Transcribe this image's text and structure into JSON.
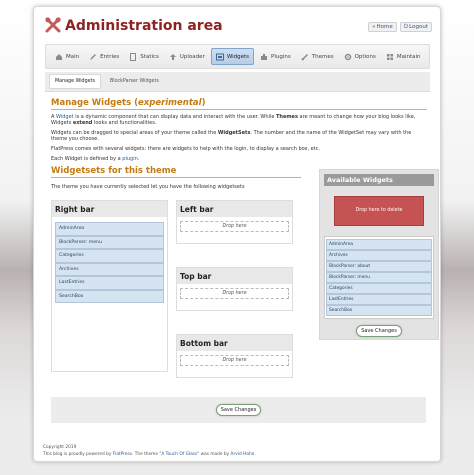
{
  "header": {
    "title": "Administration area",
    "home_label": "Home",
    "logout_label": "Logout"
  },
  "nav": {
    "items": [
      {
        "label": "Main",
        "icon": "house-icon"
      },
      {
        "label": "Entries",
        "icon": "pencil-icon"
      },
      {
        "label": "Statics",
        "icon": "page-icon"
      },
      {
        "label": "Uploader",
        "icon": "upload-icon"
      },
      {
        "label": "Widgets",
        "icon": "widgets-icon"
      },
      {
        "label": "Plugins",
        "icon": "puzzle-icon"
      },
      {
        "label": "Themes",
        "icon": "brush-icon"
      },
      {
        "label": "Options",
        "icon": "gear-icon"
      },
      {
        "label": "Maintain",
        "icon": "grid-icon"
      }
    ],
    "active": "Widgets"
  },
  "subnav": {
    "items": [
      "Manage Widgets",
      "BlockParser Widgets"
    ]
  },
  "intro": {
    "heading_main": "Manage Widgets (",
    "heading_em": "experimental",
    "heading_end": ")",
    "p1_a": "A ",
    "p1_link": "Widget",
    "p1_b": " is a dynamic component that can display data and interact with the user. While ",
    "p1_bold1": "Themes",
    "p1_c": " are meant to change how your blog looks like, Widgets ",
    "p1_bold2": "extend",
    "p1_d": " looks and functionalities.",
    "p2_a": "Widgets can be dragged to special areas of your theme called the ",
    "p2_bold": "WidgetSets",
    "p2_b": ". The number and the name of the WidgetSet may vary with the theme you choose.",
    "p3": "FlatPress comes with several widgets: there are widgets to help with the login, to display a search box, etc.",
    "p4_a": "Each Widget is defined by a ",
    "p4_link": "plugin",
    "p4_b": "."
  },
  "widgetsets": {
    "heading": "Widgetsets for this theme",
    "subtitle": "The theme you have currently selected let you have the following widgetsets",
    "right_bar": {
      "title": "Right bar",
      "items": [
        "AdminArea",
        "BlockParser: menu",
        "Categories",
        "Archives",
        "LastEntries",
        "SearchBox"
      ]
    },
    "left_bar": {
      "title": "Left bar",
      "drop": "Drop here"
    },
    "top_bar": {
      "title": "Top bar",
      "drop": "Drop here"
    },
    "bottom_bar": {
      "title": "Bottom bar",
      "drop": "Drop here"
    }
  },
  "available": {
    "title": "Available Widgets",
    "delete_label": "Drop here to delete",
    "items": [
      "AdminArea",
      "Archives",
      "BlockParser: about",
      "BlockParser: menu",
      "Categories",
      "LastEntries",
      "SearchBox"
    ],
    "save_label": "Save Changes"
  },
  "save_bottom": "Save Changes",
  "footer": {
    "line1": "Copyright 2019",
    "line2_a": "This blog is proudly powered by ",
    "line2_link1": "FlatPress",
    "line2_b": ". The theme \"",
    "line2_link2": "A Touch Of Glass",
    "line2_c": "\" was made by ",
    "line2_link3": "Arvid Hahn",
    "line2_d": "."
  },
  "colors": {
    "title": "#8d2323",
    "heading": "#c47a15",
    "delete": "#c55353",
    "widget_item": "#d6e3f1"
  }
}
